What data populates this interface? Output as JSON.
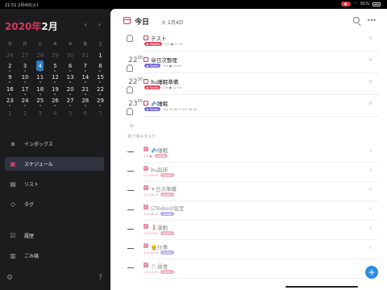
{
  "status": {
    "time": "21:51",
    "date": "2月4日(火)",
    "record": "●",
    "battery": "91%"
  },
  "sidebar": {
    "year": "2020年",
    "month": "2月",
    "prev_icon": "chevron-left-icon",
    "next_icon": "chevron-right-icon",
    "weekdays": [
      "日",
      "月",
      "火",
      "水",
      "木",
      "金",
      "土"
    ],
    "weeks": [
      [
        "26",
        "27",
        "28",
        "29",
        "30",
        "31",
        "1"
      ],
      [
        "2",
        "3",
        "4",
        "5",
        "6",
        "7",
        "8"
      ],
      [
        "9",
        "10",
        "11",
        "12",
        "13",
        "14",
        "15"
      ],
      [
        "16",
        "17",
        "18",
        "19",
        "20",
        "21",
        "22"
      ],
      [
        "23",
        "24",
        "25",
        "26",
        "27",
        "28",
        "29"
      ],
      [
        "1",
        "2",
        "3",
        "4",
        "5",
        "6",
        "7"
      ]
    ],
    "nav": [
      {
        "label": "インボックス",
        "icon": "inbox-icon"
      },
      {
        "label": "スケジュール",
        "icon": "calendar-icon"
      },
      {
        "label": "リスト",
        "icon": "list-icon"
      },
      {
        "label": "タグ",
        "icon": "tag-icon"
      },
      {
        "label": "履歴",
        "icon": "history-icon"
      },
      {
        "label": "ごみ箱",
        "icon": "trash-icon"
      }
    ],
    "settings_icon": "gear-icon",
    "help_icon": "question-icon"
  },
  "main": {
    "title": "今日",
    "subtitle": "火 2月4日",
    "search_icon": "search-icon",
    "more_icon": "more-icon",
    "tasks": [
      {
        "time_h": "",
        "time_m": "",
        "title": "テスト",
        "tag": "Todoist",
        "tag_color": "red",
        "meta": "2/4 ● 07:31",
        "right": "0"
      },
      {
        "time_h": "22",
        "time_m": "00",
        "title": "😀日次整理",
        "tag": "Sortie",
        "tag_color": "purple",
        "meta": "2/4 ● 22:00",
        "right": "0"
      },
      {
        "time_h": "22",
        "time_m": "30",
        "title": "🛏睡眠準備",
        "tag": "Sortie",
        "tag_color": "red",
        "meta": "2/4 ● 22:30",
        "right": "0"
      },
      {
        "time_h": "23",
        "time_m": "00",
        "title": "💤睡眠",
        "tag": "Sortie",
        "tag_color": "purple",
        "meta": "2/4 23:00 → 2/5 06:00",
        "right": "0"
      }
    ],
    "add_label": "+",
    "done_section_label": "完了済みタスク",
    "done": [
      {
        "title": "💤睡眠",
        "date": "2/4 ●",
        "tag": "Sortie",
        "tag_color": "red",
        "right": "0"
      },
      {
        "title": "🛏起床",
        "date": "2/4 06:00",
        "tag": "Sortie",
        "tag_color": "red",
        "right": "0"
      },
      {
        "title": "☀日次準備",
        "date": "2/4 06:15",
        "tag": "Sortie",
        "tag_color": "red",
        "right": "0"
      },
      {
        "title": "☑Todoist設定",
        "date": "2/4 06:30",
        "tag": "Sortie",
        "tag_color": "purple",
        "right": "0"
      },
      {
        "title": "🏃運動",
        "date": "2/4 07:00",
        "tag": "Sortie",
        "tag_color": "red",
        "right": "0"
      },
      {
        "title": "👷仕事",
        "date": "2/4 08:00",
        "tag": "Sortie",
        "tag_color": "purple",
        "right": "0"
      },
      {
        "title": "🍴昼食",
        "date": "2/4 12:00",
        "tag": "Sortie",
        "tag_color": "red",
        "right": "0"
      }
    ],
    "fab_label": "+"
  }
}
